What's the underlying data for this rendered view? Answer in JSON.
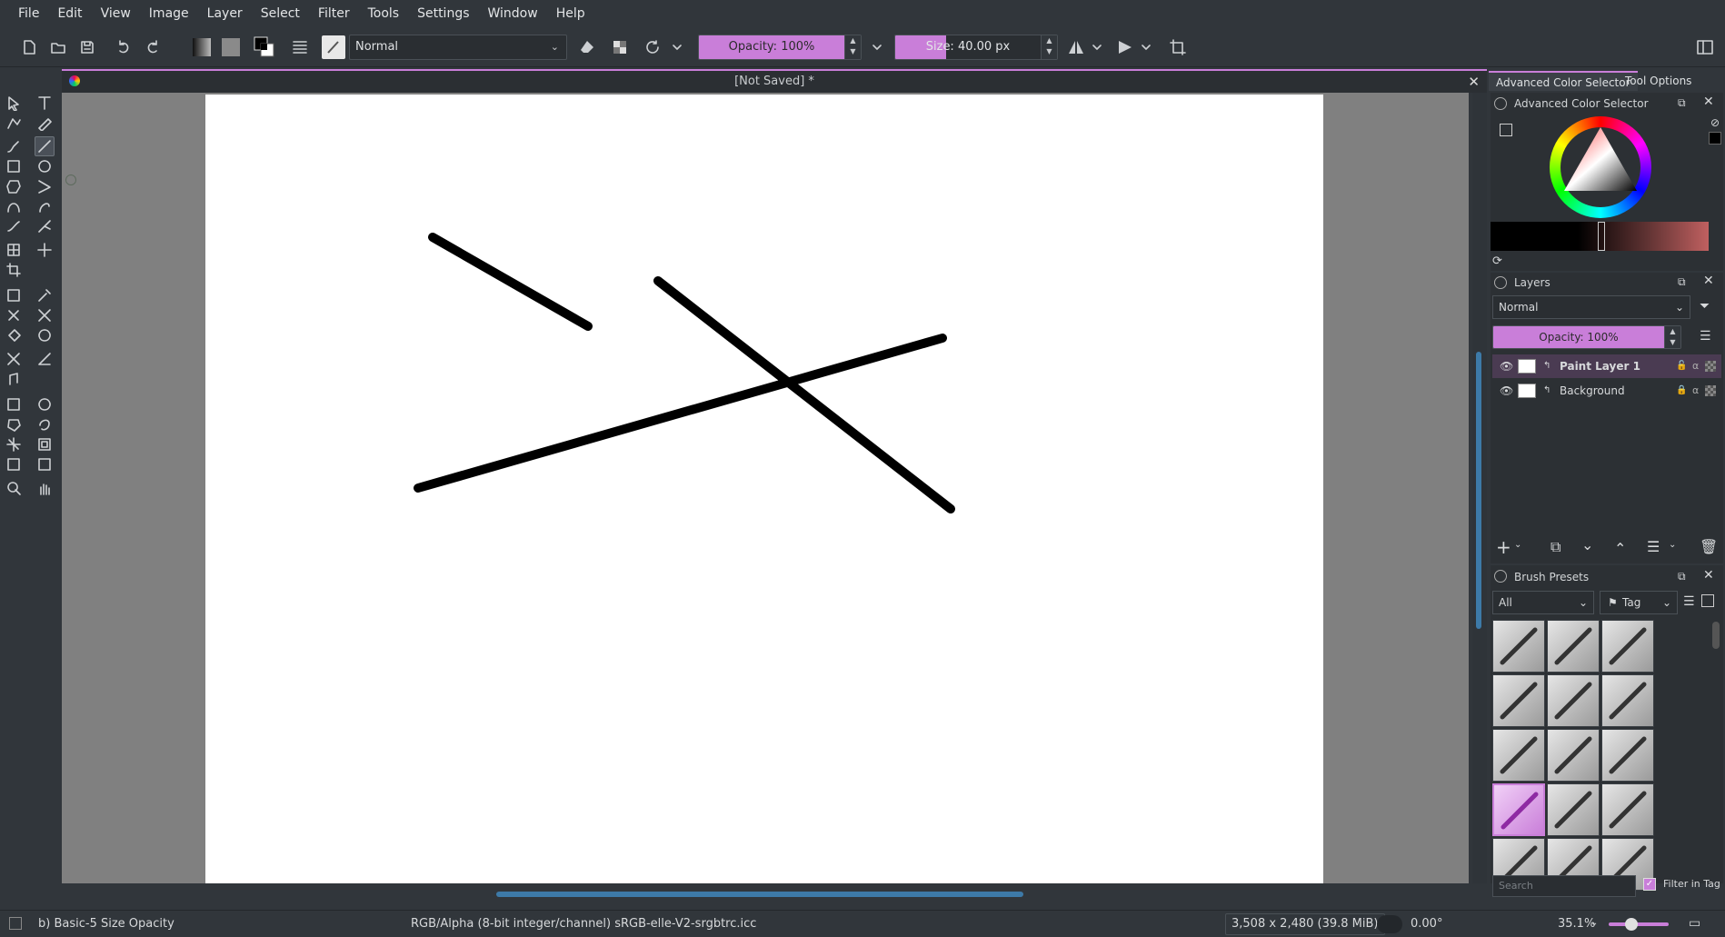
{
  "menubar": {
    "items": [
      "File",
      "Edit",
      "View",
      "Image",
      "Layer",
      "Select",
      "Filter",
      "Tools",
      "Settings",
      "Window",
      "Help"
    ]
  },
  "toolbar": {
    "blend_mode": "Normal",
    "opacity_label": "Opacity: 100%",
    "opacity_value": 100,
    "size_label": "Size: 40.00 px",
    "size_value": 40.0,
    "icons": [
      "new-document-icon",
      "open-icon",
      "save-icon",
      "undo-icon",
      "redo-icon",
      "gradient-icon",
      "pattern-icon",
      "color-swap-icon",
      "brush-settings-icon",
      "brush-preset-icon",
      "eraser-icon",
      "alpha-lock-icon",
      "reload-preset-icon",
      "mirror-horizontal-icon",
      "mirror-vertical-icon",
      "wrap-around-icon",
      "workspace-icon"
    ]
  },
  "document": {
    "title": "[Not Saved]  *"
  },
  "dockers": {
    "tabs": [
      "Advanced Color Selector",
      "Tool Options"
    ],
    "color_selector": {
      "title": "Advanced Color Selector"
    },
    "layers": {
      "title": "Layers",
      "blend_mode": "Normal",
      "opacity_label": "Opacity:  100%",
      "opacity_value": 100,
      "items": [
        {
          "name": "Paint Layer 1",
          "selected": true
        },
        {
          "name": "Background",
          "selected": false
        }
      ]
    },
    "brush_presets": {
      "title": "Brush Presets",
      "filter": "All",
      "tag_label": "Tag",
      "search_placeholder": "Search",
      "filter_in_tag_label": "Filter in Tag",
      "filter_in_tag_checked": true,
      "count": 15
    }
  },
  "statusbar": {
    "brush_name": "b) Basic-5 Size Opacity",
    "color_info": "RGB/Alpha (8-bit integer/channel)  sRGB-elle-V2-srgbtrc.icc",
    "image_size": "3,508 x 2,480 (39.8 MiB)",
    "rotation": "0.00°",
    "zoom": "35.1%"
  },
  "colors": {
    "accent": "#c97ed9",
    "background": "#31363b",
    "canvas_gray": "#808080"
  }
}
